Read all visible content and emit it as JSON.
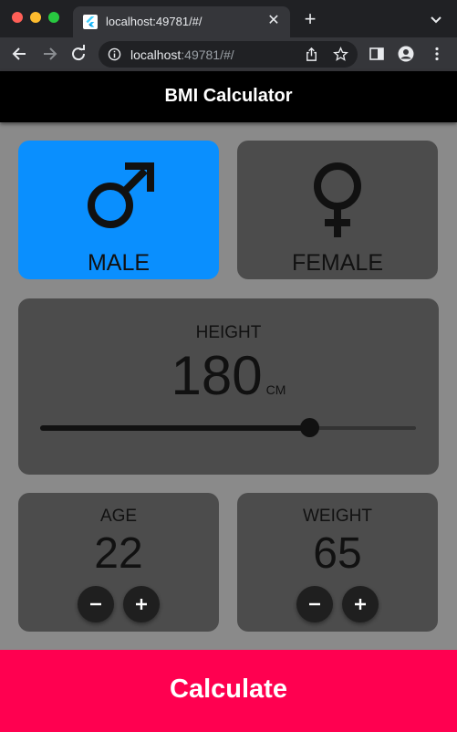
{
  "browser": {
    "tab_title": "localhost:49781/#/",
    "url_host": "localhost",
    "url_rest": ":49781/#/"
  },
  "app": {
    "title": "BMI Calculator",
    "colors": {
      "active_card": "#0a8ffe",
      "inactive_card": "#4c4c4c",
      "background": "#8a8a8a",
      "calculate_button": "#ff0050"
    }
  },
  "gender": {
    "male_label": "MALE",
    "female_label": "FEMALE",
    "selected": "MALE",
    "male_icon": "male-symbol-icon",
    "female_icon": "female-symbol-icon"
  },
  "height": {
    "label": "HEIGHT",
    "value": "180",
    "unit": "CM",
    "slider_fraction": 0.715
  },
  "age": {
    "label": "AGE",
    "value": "22"
  },
  "weight": {
    "label": "WEIGHT",
    "value": "65"
  },
  "calculate_label": "Calculate"
}
